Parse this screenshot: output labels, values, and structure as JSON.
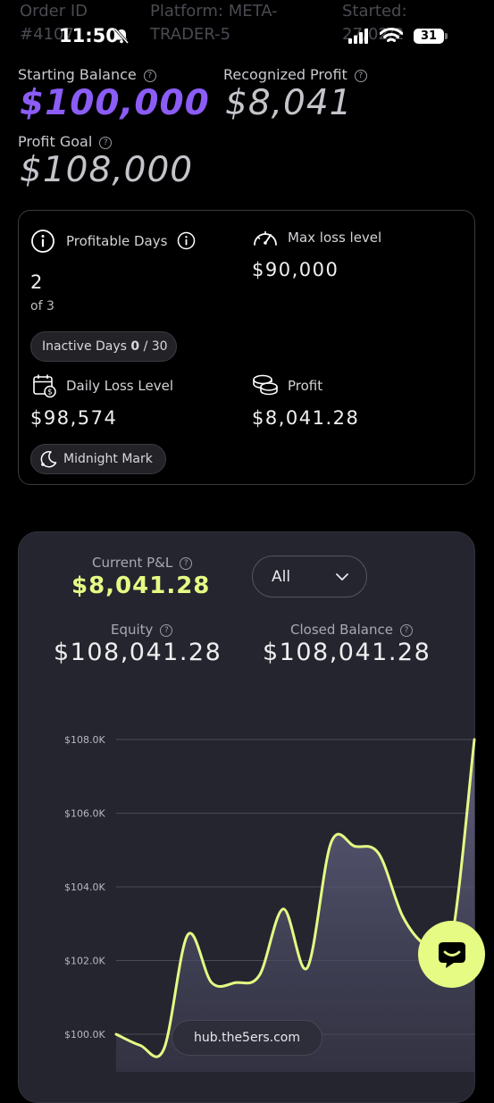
{
  "status_bar": {
    "time": "11:50",
    "battery": "31"
  },
  "bg_header": {
    "order_id_label": "Order ID",
    "order_id_value": "#4107",
    "platform_label": "Platform: META-",
    "platform_value": "TRADER-5",
    "started_label": "Started:",
    "started_value": "27/02/2"
  },
  "summary": {
    "starting_balance_label": "Starting Balance",
    "starting_balance_value": "$100,000",
    "recognized_profit_label": "Recognized Profit",
    "recognized_profit_value": "$8,041",
    "profit_goal_label": "Profit Goal",
    "profit_goal_value": "$108,000"
  },
  "card": {
    "profitable_days_label": "Profitable Days",
    "profitable_days_value": "2",
    "profitable_days_of": "of 3",
    "max_loss_label": "Max loss level",
    "max_loss_value": "$90,000",
    "inactive_days_label": "Inactive Days",
    "inactive_days_value": "0",
    "inactive_days_total": "/ 30",
    "daily_loss_label": "Daily Loss Level",
    "daily_loss_value": "$98,574",
    "profit_label": "Profit",
    "profit_value": "$8,041.28",
    "midnight_label": "Midnight Mark"
  },
  "pnl": {
    "current_label": "Current P&L",
    "current_value": "$8,041.28",
    "range_select": "All",
    "equity_label": "Equity",
    "equity_value": "$108,041.28",
    "closed_label": "Closed Balance",
    "closed_value": "$108,041.28"
  },
  "chart_data": {
    "type": "area",
    "y_ticks": [
      "$100.0K",
      "$102.0K",
      "$104.0K",
      "$106.0K",
      "$108.0K"
    ],
    "ylim": [
      100000,
      108000
    ],
    "values": [
      100000,
      99700,
      99600,
      102700,
      101400,
      101400,
      101600,
      103400,
      101800,
      105200,
      105100,
      104900,
      103200,
      102400,
      102400,
      108000
    ],
    "line_color": "#e5fb84"
  },
  "footer": {
    "url": "hub.the5ers.com"
  },
  "colors": {
    "accent_purple": "#8b5cf6",
    "accent_green": "#e5fb84",
    "panel": "#25252f"
  }
}
